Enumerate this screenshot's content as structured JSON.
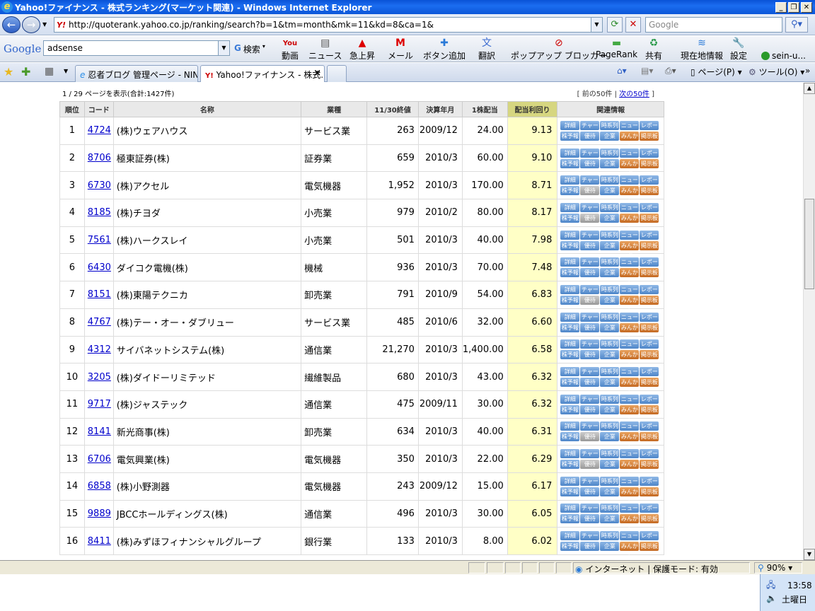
{
  "window": {
    "title": "Yahoo!ファイナンス - 株式ランキング(マーケット関連) - Windows Internet Explorer"
  },
  "nav": {
    "url": "http://quoterank.yahoo.co.jp/ranking/search?b=1&tm=month&mk=11&kd=8&ca=1&",
    "search_placeholder": "Google",
    "yahoo_label": "Y!"
  },
  "gbar": {
    "logo": "Google",
    "query": "adsense",
    "search_label": "検索",
    "tools": [
      {
        "icon": "You",
        "label": "動画"
      },
      {
        "icon": "▤",
        "label": "ニュース"
      },
      {
        "icon": "▲",
        "label": "急上昇"
      },
      {
        "icon": "M",
        "label": "メール"
      },
      {
        "icon": "✚",
        "label": "ボタン追加"
      },
      {
        "icon": "文",
        "label": "翻訳"
      },
      {
        "icon": "⊘",
        "label": "ポップアップ ブロッカー"
      },
      {
        "icon": "▬",
        "label": "PageRank"
      },
      {
        "icon": "♻",
        "label": "共有"
      },
      {
        "icon": "≋",
        "label": "現在地情報"
      },
      {
        "icon": "🔧",
        "label": "設定"
      }
    ],
    "user": "sein-u..."
  },
  "tabs": [
    {
      "label": "忍者ブログ 管理ページ - NIN..."
    },
    {
      "label": "Yahoo!ファイナンス - 株式...",
      "close": "×"
    }
  ],
  "tabtools": {
    "page": "ページ(P)",
    "tools": "ツール(O)"
  },
  "page": {
    "info": "1 / 29 ページを表示(合計:1427件)",
    "prev": "[ 前の50件 |",
    "next": "次の50件",
    "next_close": "]"
  },
  "table": {
    "headers": [
      "順位",
      "コード",
      "名称",
      "業種",
      "11/30終値",
      "決算年月",
      "1株配当",
      "配当利回り",
      "関連情報"
    ],
    "buttons_top": [
      "詳細",
      "チャート",
      "時系列",
      "ニュース",
      "レポート"
    ],
    "buttons_bottom": [
      "株予報",
      "優待",
      "企業",
      "みんかぶ",
      "掲示板"
    ],
    "rows": [
      {
        "rank": "1",
        "code": "4724",
        "name": "(株)ウェアハウス",
        "industry": "サービス業",
        "price": "263",
        "period": "2009/12",
        "div": "24.00",
        "yield": "9.13"
      },
      {
        "rank": "2",
        "code": "8706",
        "name": "極東証券(株)",
        "industry": "証券業",
        "price": "659",
        "period": "2010/3",
        "div": "60.00",
        "yield": "9.10"
      },
      {
        "rank": "3",
        "code": "6730",
        "name": "(株)アクセル",
        "industry": "電気機器",
        "price": "1,952",
        "period": "2010/3",
        "div": "170.00",
        "yield": "8.71"
      },
      {
        "rank": "4",
        "code": "8185",
        "name": "(株)チヨダ",
        "industry": "小売業",
        "price": "979",
        "period": "2010/2",
        "div": "80.00",
        "yield": "8.17"
      },
      {
        "rank": "5",
        "code": "7561",
        "name": "(株)ハークスレイ",
        "industry": "小売業",
        "price": "501",
        "period": "2010/3",
        "div": "40.00",
        "yield": "7.98"
      },
      {
        "rank": "6",
        "code": "6430",
        "name": "ダイコク電機(株)",
        "industry": "機械",
        "price": "936",
        "period": "2010/3",
        "div": "70.00",
        "yield": "7.48"
      },
      {
        "rank": "7",
        "code": "8151",
        "name": "(株)東陽テクニカ",
        "industry": "卸売業",
        "price": "791",
        "period": "2010/9",
        "div": "54.00",
        "yield": "6.83"
      },
      {
        "rank": "8",
        "code": "4767",
        "name": "(株)テー・オー・ダブリュー",
        "industry": "サービス業",
        "price": "485",
        "period": "2010/6",
        "div": "32.00",
        "yield": "6.60"
      },
      {
        "rank": "9",
        "code": "4312",
        "name": "サイバネットシステム(株)",
        "industry": "通信業",
        "price": "21,270",
        "period": "2010/3",
        "div": "1,400.00",
        "yield": "6.58"
      },
      {
        "rank": "10",
        "code": "3205",
        "name": "(株)ダイドーリミテッド",
        "industry": "繊維製品",
        "price": "680",
        "period": "2010/3",
        "div": "43.00",
        "yield": "6.32"
      },
      {
        "rank": "11",
        "code": "9717",
        "name": "(株)ジャステック",
        "industry": "通信業",
        "price": "475",
        "period": "2009/11",
        "div": "30.00",
        "yield": "6.32"
      },
      {
        "rank": "12",
        "code": "8141",
        "name": "新光商事(株)",
        "industry": "卸売業",
        "price": "634",
        "period": "2010/3",
        "div": "40.00",
        "yield": "6.31"
      },
      {
        "rank": "13",
        "code": "6706",
        "name": "電気興業(株)",
        "industry": "電気機器",
        "price": "350",
        "period": "2010/3",
        "div": "22.00",
        "yield": "6.29"
      },
      {
        "rank": "14",
        "code": "6858",
        "name": "(株)小野測器",
        "industry": "電気機器",
        "price": "243",
        "period": "2009/12",
        "div": "15.00",
        "yield": "6.17"
      },
      {
        "rank": "15",
        "code": "9889",
        "name": "JBCCホールディングス(株)",
        "industry": "通信業",
        "price": "496",
        "period": "2010/3",
        "div": "30.00",
        "yield": "6.05"
      },
      {
        "rank": "16",
        "code": "8411",
        "name": "(株)みずほフィナンシャルグループ",
        "industry": "銀行業",
        "price": "133",
        "period": "2010/3",
        "div": "8.00",
        "yield": "6.02"
      }
    ]
  },
  "status": {
    "zone": "インターネット | 保護モード: 有効",
    "zoom": "90%"
  },
  "tray": {
    "time": "13:58",
    "day": "土曜日"
  }
}
